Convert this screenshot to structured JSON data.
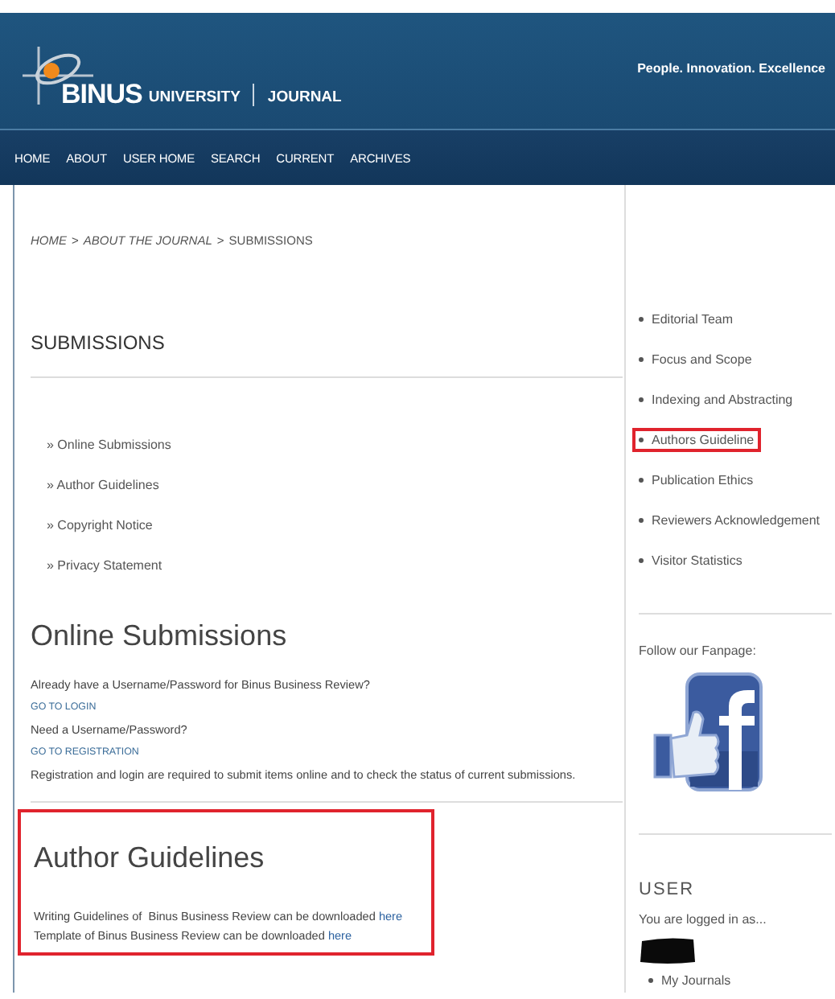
{
  "header": {
    "logo_text": "BINUS",
    "logo_sub": "UNIVERSITY",
    "journal": "JOURNAL",
    "tagline": "People. Innovation. Excellence"
  },
  "nav": [
    {
      "label": "HOME"
    },
    {
      "label": "ABOUT"
    },
    {
      "label": "USER HOME"
    },
    {
      "label": "SEARCH"
    },
    {
      "label": "CURRENT"
    },
    {
      "label": "ARCHIVES"
    }
  ],
  "breadcrumb": [
    {
      "label": "HOME",
      "kind": "link"
    },
    {
      "label": ">",
      "kind": "sep"
    },
    {
      "label": "ABOUT THE JOURNAL",
      "kind": "link"
    },
    {
      "label": ">",
      "kind": "sep"
    },
    {
      "label": "SUBMISSIONS",
      "kind": "current"
    }
  ],
  "page_title": "SUBMISSIONS",
  "section_links": [
    "» Online Submissions",
    "» Author Guidelines",
    "» Copyright Notice",
    "» Privacy Statement"
  ],
  "online_submissions": {
    "heading": "Online Submissions",
    "lines": [
      {
        "kind": "text",
        "text": "Already have a Username/Password for Binus Business Review?"
      },
      {
        "kind": "link",
        "text": "GO TO LOGIN"
      },
      {
        "kind": "text",
        "text": "Need a Username/Password?"
      },
      {
        "kind": "link",
        "text": "GO TO REGISTRATION"
      },
      {
        "kind": "text",
        "text": "Registration and login are required to submit items online and to check the status of current submissions."
      }
    ]
  },
  "author_guidelines": {
    "heading": "Author Guidelines",
    "highlighted": true,
    "lines": [
      {
        "text": "Writing Guidelines of  Binus Business Review can be downloaded",
        "link": "here"
      },
      {
        "text": "Template of Binus Business Review can be downloaded",
        "link": "here"
      }
    ]
  },
  "sidebar": {
    "items": [
      {
        "label": "Editorial Team",
        "highlighted": false
      },
      {
        "label": "Focus and Scope",
        "highlighted": false
      },
      {
        "label": "Indexing and Abstracting",
        "highlighted": false
      },
      {
        "label": "Authors Guideline",
        "highlighted": true
      },
      {
        "label": "Publication Ethics",
        "highlighted": false
      },
      {
        "label": "Reviewers Acknowledgement",
        "highlighted": false
      },
      {
        "label": "Visitor Statistics",
        "highlighted": false
      }
    ],
    "fanpage_label": "Follow our Fanpage:",
    "user": {
      "heading": "USER",
      "logged_in": "You are logged in as...",
      "items": [
        "My Journals"
      ]
    }
  }
}
